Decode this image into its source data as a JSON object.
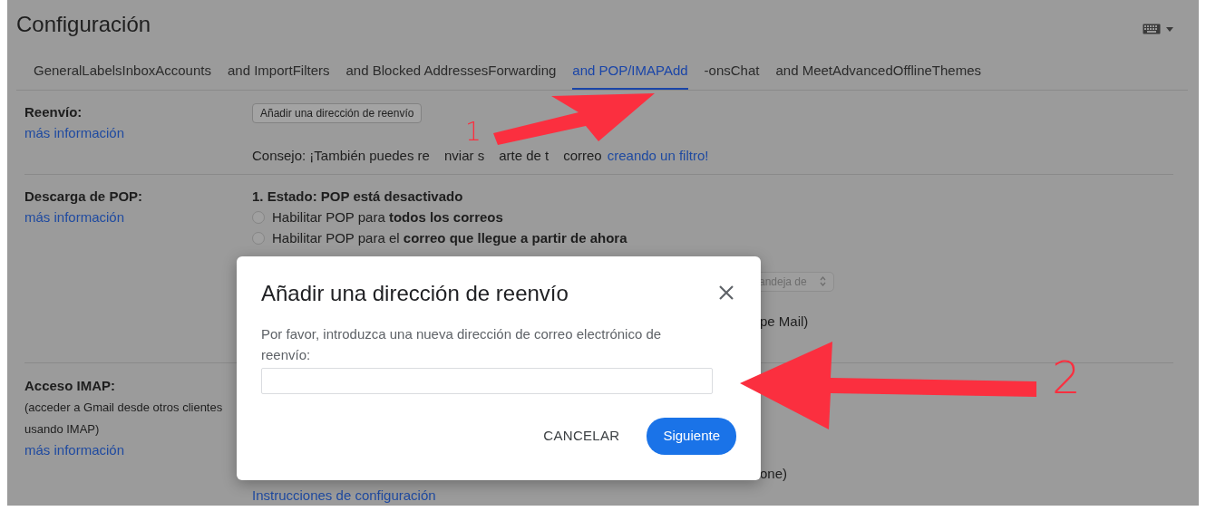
{
  "page": {
    "title": "Configuración"
  },
  "tabs": [
    {
      "label": "GeneralLabelsInboxAccounts",
      "selected": false
    },
    {
      "label": "and ImportFilters",
      "selected": false
    },
    {
      "label": "and Blocked AddressesForwarding",
      "selected": false
    },
    {
      "label": "and POP/IMAPAdd",
      "selected": true
    },
    {
      "label": "-onsChat",
      "selected": false
    },
    {
      "label": "and MeetAdvancedOfflineThemes",
      "selected": false
    }
  ],
  "forwarding": {
    "label": "Reenvío:",
    "more_info": "más información",
    "add_button": "Añadir una dirección de reenvío",
    "tip_parts": [
      "Consejo: ¡También puedes re",
      "nviar s",
      "arte de t",
      "correo"
    ],
    "tip_link": "creando un filtro!"
  },
  "pop": {
    "label": "Descarga de POP:",
    "more_info": "más información",
    "status": "1. Estado: POP está desactivado",
    "options": [
      {
        "label": "Habilitar POP para **todos los correos**",
        "selected": false
      },
      {
        "label": "Habilitar POP para el **correo que llegue a partir de ahora**",
        "selected": false
      }
    ],
    "select_value": "andeja de",
    "partial_text": "pe Mail)"
  },
  "imap": {
    "label": "Acceso IMAP:",
    "note_lines": [
      "(acceder a Gmail desde otros clientes",
      "usando IMAP)"
    ],
    "more_info": "más información",
    "partial_text": "one)",
    "setup_link": "Instrucciones de configuración"
  },
  "dialog": {
    "title": "Añadir una dirección de reenvío",
    "message": "Por favor, introduzca una nueva dirección de correo electrónico de reenvío:",
    "buttons": [
      {
        "label": "CANCELAR",
        "kind": "text"
      },
      {
        "label": "Siguiente",
        "kind": "primary"
      }
    ]
  },
  "annotations": [
    {
      "label": "1"
    },
    {
      "label": "2"
    }
  ]
}
